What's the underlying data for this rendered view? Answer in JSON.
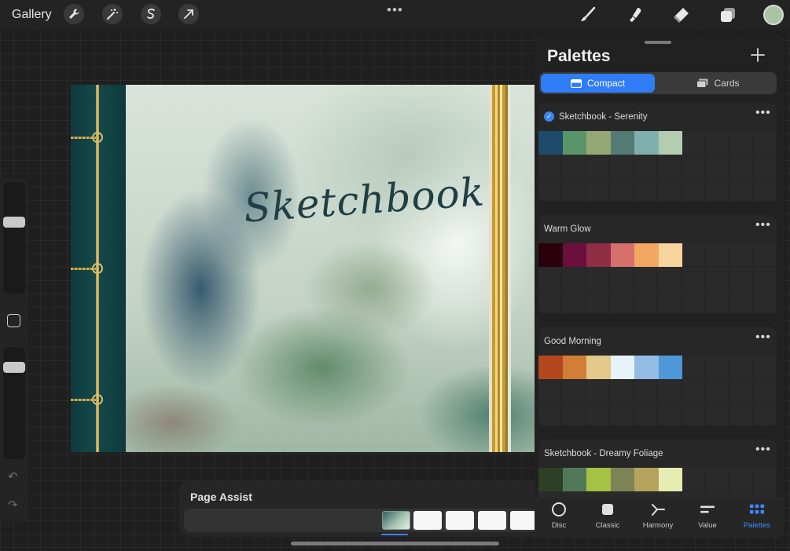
{
  "topbar": {
    "gallery_label": "Gallery",
    "tools_left": [
      "wrench-icon",
      "magic-wand-icon",
      "selection-icon",
      "transform-arrow-icon"
    ],
    "more_label": "•••",
    "tools_right": [
      "brush-icon",
      "smudge-icon",
      "eraser-icon",
      "layers-icon"
    ],
    "current_color": "#a8c4a2"
  },
  "canvas": {
    "script_title": "Sketchbook"
  },
  "page_assist": {
    "title": "Page Assist"
  },
  "palettes_panel": {
    "title": "Palettes",
    "add_label": "+",
    "view_modes": [
      "Compact",
      "Cards"
    ],
    "active_view_mode": "Compact",
    "palettes": [
      {
        "name": "Sketchbook - Serenity",
        "is_default": true,
        "colors": [
          "#1e4a6c",
          "#5a9469",
          "#95a775",
          "#547a74",
          "#7fb0ae",
          "#b3cdb0"
        ]
      },
      {
        "name": "Warm Glow",
        "is_default": false,
        "colors": [
          "#2a000c",
          "#6b0f3c",
          "#8f2e44",
          "#d7706a",
          "#f2a862",
          "#f9d59e"
        ]
      },
      {
        "name": "Good Morning",
        "is_default": false,
        "colors": [
          "#b5471e",
          "#d17f36",
          "#e2c98b",
          "#e6f3fb",
          "#93bce4",
          "#4e97d9"
        ]
      },
      {
        "name": "Sketchbook - Dreamy Foliage",
        "is_default": false,
        "colors": [
          "#2d3f25",
          "#52785a",
          "#a6c242",
          "#7d8354",
          "#b6a35c",
          "#e5edb3"
        ]
      }
    ],
    "more_label": "•••",
    "tabs": [
      {
        "label": "Disc",
        "icon": "disc-icon"
      },
      {
        "label": "Classic",
        "icon": "classic-square-icon"
      },
      {
        "label": "Harmony",
        "icon": "harmony-icon"
      },
      {
        "label": "Value",
        "icon": "value-sliders-icon"
      },
      {
        "label": "Palettes",
        "icon": "palettes-grid-icon"
      }
    ],
    "active_tab": "Palettes"
  }
}
